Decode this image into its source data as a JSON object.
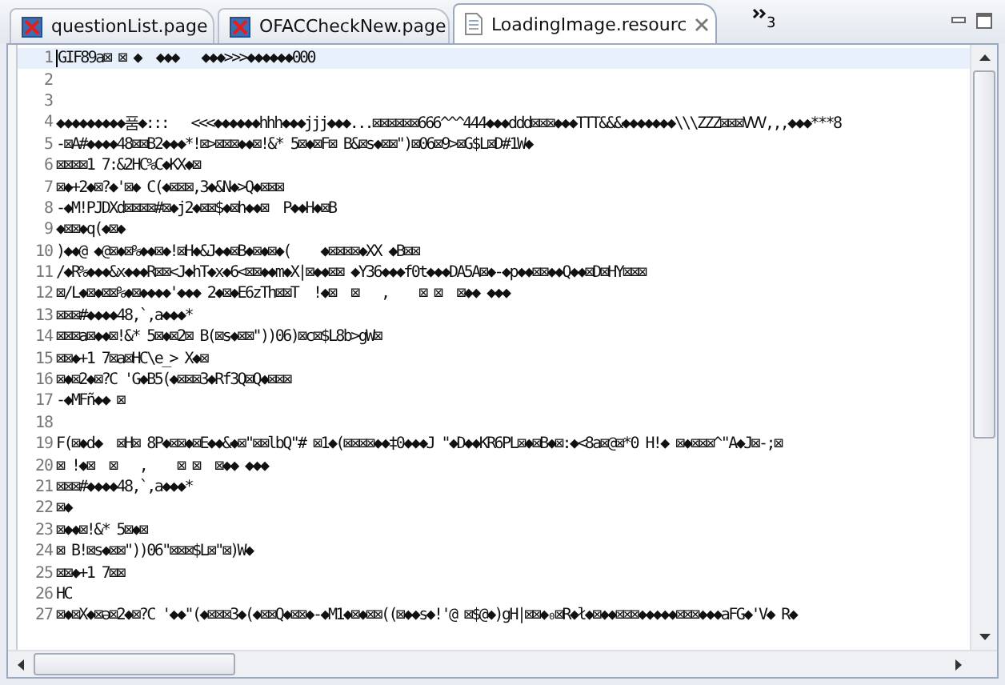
{
  "tabs": [
    {
      "label": "questionList.page",
      "kind": "page",
      "selected": false
    },
    {
      "label": "OFACCheckNew.page",
      "kind": "page",
      "selected": false
    },
    {
      "label": "LoadingImage.resourc",
      "kind": "file",
      "selected": true
    }
  ],
  "overflow_count": "3",
  "editor": {
    "lines": [
      {
        "number": "1",
        "text": "GIF89a⊠ ⊠ ◆  ◆◆◆   ◆◆◆>>>◆◆◆◆◆◆000",
        "current": true
      },
      {
        "number": "2",
        "current": false
      },
      {
        "number": "3",
        "current": false
      },
      {
        "number": "4",
        "text": "◆◆◆◆◆◆◆◆◆품◆:::   <<<◆◆◆◆◆◆hhh◆◆◆jjj◆◆◆...⊠⊠⊠⊠⊠⊠666^^^444◆◆◆ddd⊠⊠⊠◆◆◆TTT&&&◆◆◆◆◆◆◆\\\\\\ZZZ⊠⊠⊠VVV,,,◆◆◆***8",
        "current": false
      },
      {
        "number": "5",
        "text": "-⊠A#◆◆◆◆48⊠⊠B2◆◆◆*!⊠>⊠⊠⊠◆◆⊠!&* 5⊠◆⊠F⊠ B&⊠s◆⊠⊠\")⊠06⊠9>⊠G$L⊠D#1W◆",
        "current": false
      },
      {
        "number": "6",
        "text": "⊠⊠⊠⊠1 7:&2HC%C◆KX◆⊠",
        "current": false
      },
      {
        "number": "7",
        "text": "⊠◆+2◆⊠?◆'⊠◆ C(◆⊠⊠⊠,3◆&N◆>Q◆⊠⊠⊠",
        "current": false
      },
      {
        "number": "8",
        "text": "-◆M!PJDXd⊠⊠⊠⊠#⊠◆j2◆⊠⊠$◆⊠h◆◆⊠  P◆◆H◆⊠B",
        "current": false
      },
      {
        "number": "9",
        "text": "◆⊠⊠◆q(◆⊠◆",
        "current": false
      },
      {
        "number": "10",
        "text": ")◆◆@ ◆@⊠◆⊠%◆◆⊠◆!⊠H◆&J◆◆⊠B◆⊠◆⊠◆(    ◆⊠⊠⊠⊠◆XX ◆B⊠⊠",
        "current": false
      },
      {
        "number": "11",
        "text": "/◆R%◆◆◆&x◆◆◆R⊠⊠<J◆hT◆x◆6<⊠⊠◆◆m◆X|⊠◆◆⊠⊠ ◆Y36◆◆◆f0t◆◆◆DA5A⊠◆-◆p◆◆⊠⊠◆◆Q◆◆⊠D⊠HY⊠⊠⊠",
        "current": false
      },
      {
        "number": "12",
        "text": "⊠/L◆⊠◆⊠⊠%◆⊠◆◆◆◆'◆◆◆ 2◆⊠◆E6zTh⊠⊠T  !◆⊠  ⊠   ,    ⊠ ⊠  ⊠◆◆ ◆◆◆",
        "current": false
      },
      {
        "number": "13",
        "text": "⊠⊠⊠#◆◆◆◆48,`,a◆◆◆*",
        "current": false
      },
      {
        "number": "14",
        "text": "⊠⊠⊠a⊠◆◆⊠!&* 5⊠◆⊠2⊠ B(⊠s◆⊠⊠\"))06)⊠c⊠$L8b>gW⊠",
        "current": false
      },
      {
        "number": "15",
        "text": "⊠⊠◆+1 7⊠a⊠HC\\e_> X◆⊠",
        "current": false
      },
      {
        "number": "16",
        "text": "⊠◆⊠2◆⊠?C 'G◆B5(◆⊠⊠⊠3◆Rf3Q⊠Q◆⊠⊠⊠",
        "current": false
      },
      {
        "number": "17",
        "text": "-◆MFñ◆◆ ⊠",
        "current": false
      },
      {
        "number": "18",
        "current": false
      },
      {
        "number": "19",
        "text": "F(⊠◆d◆  ⊠H⊠ 8P◆⊠⊠◆⊠E◆◆&◆⊠\"⊠⊠lbQ\"# ⊠1◆(⊠⊠⊠⊠◆◆‡0◆◆◆J \"◆D◆◆KR6PL⊠◆⊠B◆⊠:◆<8a⊠@⊠*0 H!◆ ⊠◆⊠⊠⊠^\"A◆J⊠-;⊠",
        "current": false
      },
      {
        "number": "20",
        "text": "⊠ !◆⊠  ⊠   ,    ⊠ ⊠  ⊠◆◆ ◆◆◆",
        "current": false
      },
      {
        "number": "21",
        "text": "⊠⊠⊠#◆◆◆◆48,`,a◆◆◆*",
        "current": false
      },
      {
        "number": "22",
        "text": "⊠◆",
        "current": false
      },
      {
        "number": "23",
        "text": "⊠◆◆⊠!&* 5⊠◆⊠",
        "current": false
      },
      {
        "number": "24",
        "text": "⊠ B!⊠s◆⊠⊠\"))06\"⊠⊠⊠$L⊠\"⊠)W◆",
        "current": false
      },
      {
        "number": "25",
        "text": "⊠⊠◆+1 7⊠⊠",
        "current": false
      },
      {
        "number": "26",
        "text": "HC",
        "current": false
      },
      {
        "number": "27",
        "text": "⊠◆⊠X◆⊠ə⊠2◆⊠?C '◆◆\"(◆⊠⊠⊠3◆(◆⊠⊠Q◆⊠⊠◆-◆M1◆⊠◆⊠⊠((⊠◆◆s◆!'@ ⊠$@◆)gH|⊠⊠◆₀⊠R◆ł◆⊠◆◆⊠⊠⊠◆◆◆◆◆⊠⊠⊠◆◆◆aFG◆'V◆ R◆",
        "current": false
      }
    ]
  }
}
